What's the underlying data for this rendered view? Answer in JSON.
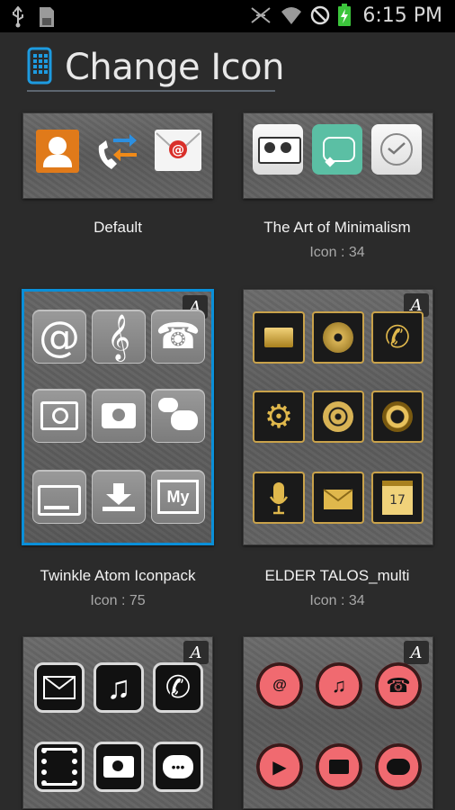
{
  "status_bar": {
    "time": "6:15 PM",
    "icons": [
      "usb-icon",
      "sd-card-icon",
      "vibrate-icon",
      "wifi-icon",
      "blocked-icon",
      "battery-charging-icon"
    ]
  },
  "header": {
    "title": "Change Icon",
    "icon": "phone-grid-icon"
  },
  "themes": [
    {
      "name": "Default",
      "icon_count": "",
      "selected": false
    },
    {
      "name": "The Art of Minimalism",
      "icon_count": "Icon : 34",
      "selected": false
    },
    {
      "name": "Twinkle Atom Iconpack",
      "icon_count": "Icon : 75",
      "selected": true
    },
    {
      "name": "ELDER TALOS_multi",
      "icon_count": "Icon : 34",
      "selected": false
    },
    {
      "name": "",
      "icon_count": "",
      "selected": false
    },
    {
      "name": "",
      "icon_count": "",
      "selected": false
    }
  ],
  "badge_glyph": "A",
  "colors": {
    "selection": "#0a8fd8",
    "gold": "#c9a24a",
    "red_theme": "#d9404a"
  }
}
